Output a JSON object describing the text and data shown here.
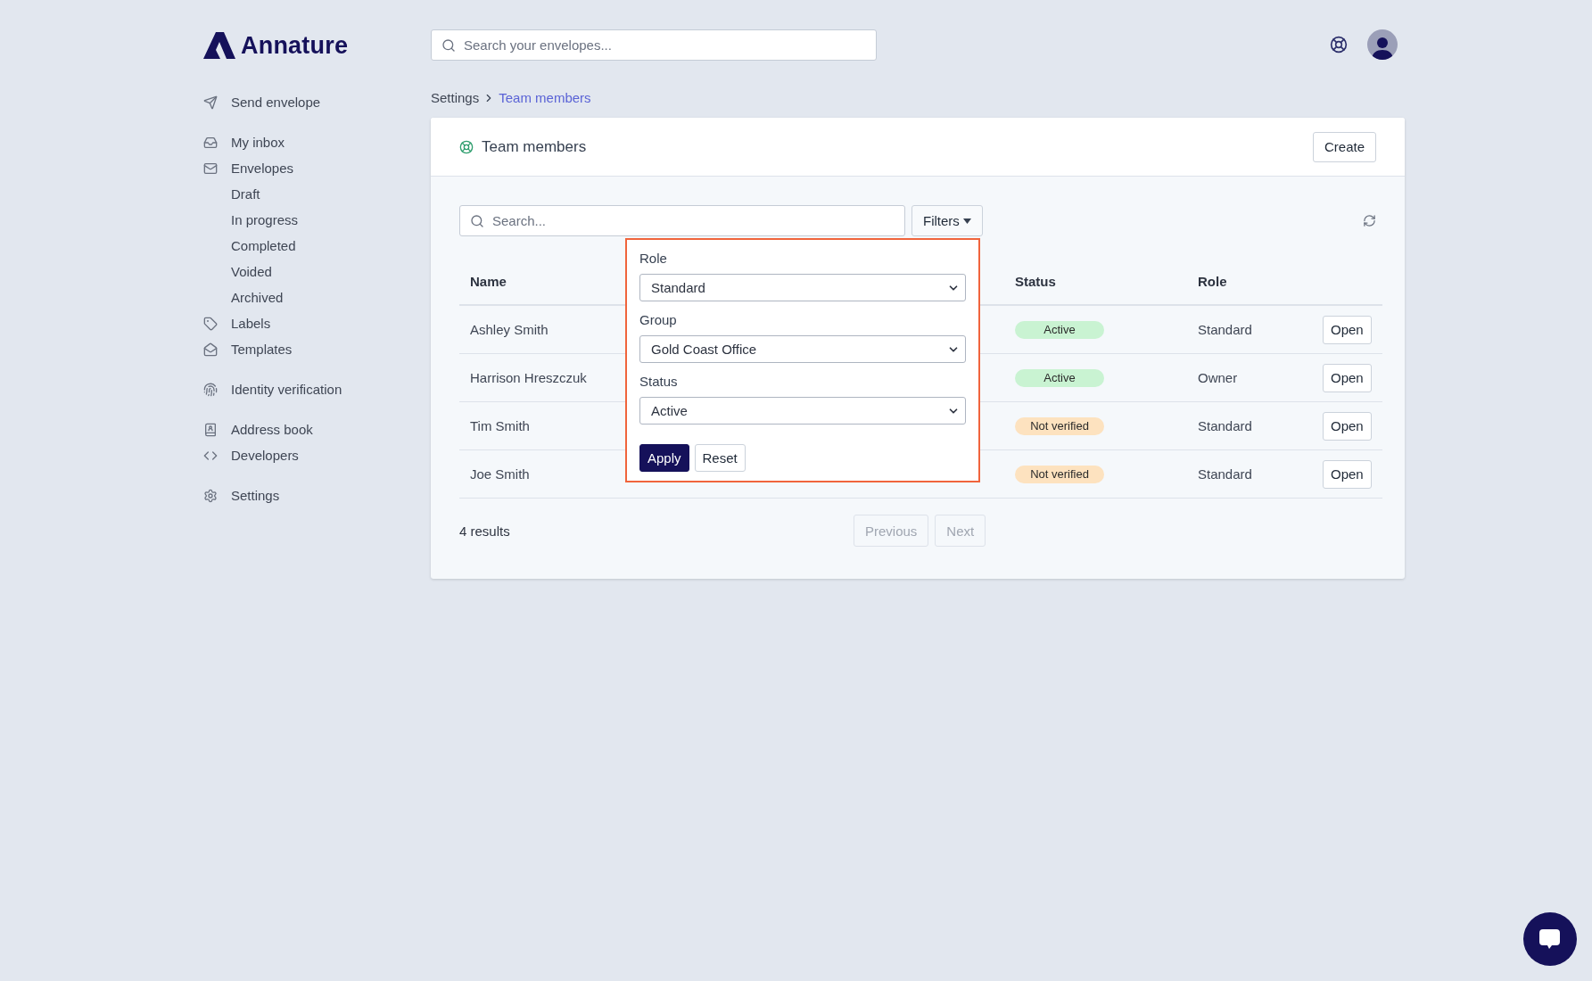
{
  "brand": {
    "name": "Annature"
  },
  "top_search": {
    "placeholder": "Search your envelopes..."
  },
  "sidebar": {
    "groups": [
      [
        {
          "label": "Send envelope"
        }
      ],
      [
        {
          "label": "My inbox"
        },
        {
          "label": "Envelopes",
          "children": [
            {
              "label": "Draft"
            },
            {
              "label": "In progress"
            },
            {
              "label": "Completed"
            },
            {
              "label": "Voided"
            },
            {
              "label": "Archived"
            }
          ]
        },
        {
          "label": "Labels"
        },
        {
          "label": "Templates"
        }
      ],
      [
        {
          "label": "Identity verification"
        }
      ],
      [
        {
          "label": "Address book"
        },
        {
          "label": "Developers"
        }
      ],
      [
        {
          "label": "Settings"
        }
      ]
    ]
  },
  "breadcrumb": [
    {
      "label": "Settings",
      "current": false
    },
    {
      "label": "Team members",
      "current": true
    }
  ],
  "card": {
    "title": "Team members",
    "create_button": "Create"
  },
  "search": {
    "placeholder": "Search..."
  },
  "filters_button": "Filters",
  "table": {
    "columns": [
      "Name",
      "Status",
      "Role"
    ],
    "rows": [
      {
        "name": "Ashley Smith",
        "status": "Active",
        "color": "#c9f3d2",
        "role": "Standard",
        "action": "Open"
      },
      {
        "name": "Harrison Hreszczuk",
        "status": "Active",
        "color": "#c9f3d2",
        "role": "Owner",
        "action": "Open"
      },
      {
        "name": "Tim Smith",
        "status": "Not verified",
        "color": "#fde2bf",
        "role": "Standard",
        "action": "Open"
      },
      {
        "name": "Joe Smith",
        "status": "Not verified",
        "color": "#fde2bf",
        "role": "Standard",
        "action": "Open"
      }
    ]
  },
  "filter_panel": {
    "fields": [
      {
        "label": "Role",
        "value": "Standard"
      },
      {
        "label": "Group",
        "value": "Gold Coast Office"
      },
      {
        "label": "Status",
        "value": "Active"
      }
    ],
    "apply_button": "Apply",
    "reset_button": "Reset"
  },
  "results": "4 results",
  "pagination": [
    {
      "label": "Previous",
      "disabled": true
    },
    {
      "label": "Next",
      "disabled": true
    }
  ]
}
